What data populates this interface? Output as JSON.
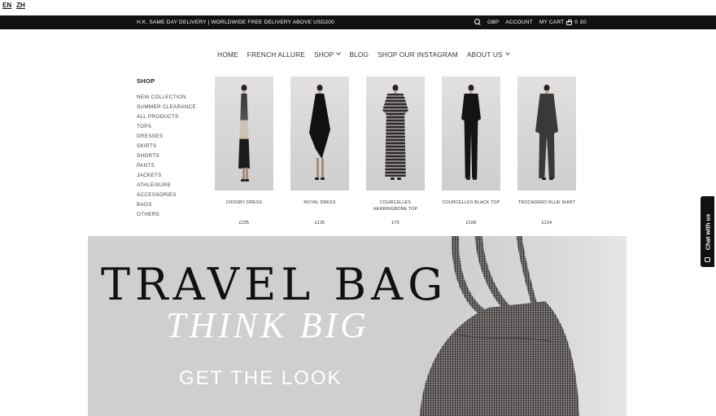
{
  "lang": {
    "en": "EN",
    "zh": "ZH"
  },
  "topbar": {
    "promo": "H.K. SAME DAY DELIVERY | WORLDWIDE FREE DELIVERY ABOVE USD200",
    "currency": "GBP",
    "account": "ACCOUNT",
    "cart_label": "MY CART",
    "cart_count": "0",
    "cart_total": "£0"
  },
  "nav": {
    "home": "HOME",
    "french_allure": "FRENCH ALLURE",
    "shop": "SHOP",
    "blog": "BLOG",
    "instagram": "SHOP OUR INSTAGRAM",
    "about": "ABOUT US"
  },
  "sidebar": {
    "heading": "SHOP",
    "items": [
      "NEW COLLECTION",
      "SUMMER CLEARANCE",
      "ALL PRODUCTS",
      "TOPS",
      "DRESSES",
      "SKIRTS",
      "SHORTS",
      "PANTS",
      "JACKETS",
      "ATHLEISURE",
      "ACCESSORIES",
      "BAGS",
      "OTHERS"
    ]
  },
  "products": [
    {
      "name": "CROSBY DRESS",
      "price": "£235"
    },
    {
      "name": "ROYAL DRESS",
      "price": "£135"
    },
    {
      "name": "COURCELLES HERRINGBONE TOP",
      "price": "£79"
    },
    {
      "name": "COURCELLES BLACK TOP",
      "price": "£108"
    },
    {
      "name": "TROCADERO BLUE SHIRT",
      "price": "£124"
    }
  ],
  "banner": {
    "title": "TRAVEL BAG",
    "subtitle": "THINK BIG",
    "cta": "GET THE LOOK"
  },
  "chat": {
    "label": "Chat with us"
  },
  "colors": {
    "topbar_bg": "#111111",
    "banner_bg": "#cfcfd1"
  }
}
